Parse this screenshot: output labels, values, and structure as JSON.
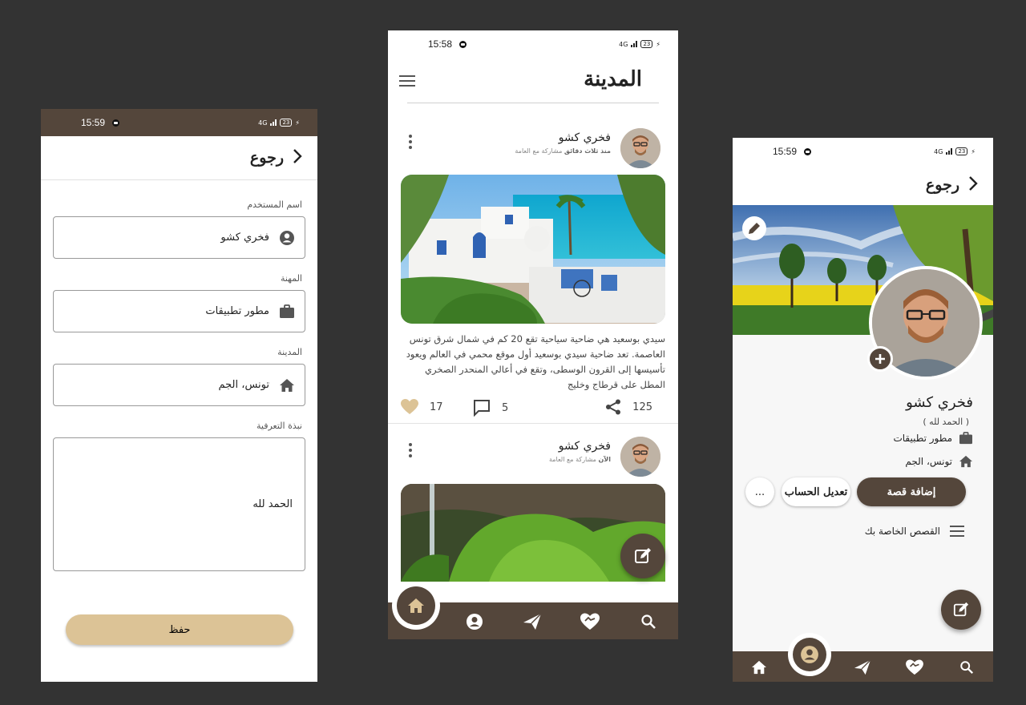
{
  "status_bar": {
    "edit_time": "15:59",
    "feed_time": "15:58",
    "profile_time": "15:59",
    "network": "4G",
    "battery": "23"
  },
  "edit_profile": {
    "back_label": "رجوع",
    "username_label": "اسم المستخدم",
    "username_value": "فخري كشو",
    "job_label": "المهنة",
    "job_value": "مطور تطبيقات",
    "city_label": "المدينة",
    "city_value": "تونس، الجم",
    "bio_label": "نبذة التعرفية",
    "bio_value": "الحمد لله",
    "save_label": "حفظ"
  },
  "feed": {
    "brand": "المدينة",
    "posts": [
      {
        "author": "فخري كشو",
        "time": "منذ ثلاث دقائق",
        "visibility": "مشاركة مع العامة",
        "text": "سيدي بوسعيد هي ضاحية سياحية تقع 20 كم في شمال شرق تونس العاصمة. تعد ضاحية سيدي بوسعيد أول موقع محمي في العالم ويعود تأسيسها إلى القرون الوسطى، وتقع في أعالي المنحدر الصخري المطل على قرطاج وخليج",
        "likes": "17",
        "comments": "5",
        "shares": "125"
      },
      {
        "author": "فخري كشو",
        "time": "الآن",
        "visibility": "مشاركة مع العامة"
      }
    ]
  },
  "profile": {
    "back_label": "رجوع",
    "name": "فخري كشو",
    "bio": "( الحمد لله )",
    "job": "مطور تطبيقات",
    "city": "تونس، الجم",
    "add_story_label": "إضافة قصة",
    "edit_account_label": "تعديل الحساب",
    "more_label": "...",
    "stories_label": "القصص الخاصة بك"
  },
  "colors": {
    "primary": "#54463b",
    "save_button": "#dcc396",
    "like_heart": "#dcc396"
  }
}
